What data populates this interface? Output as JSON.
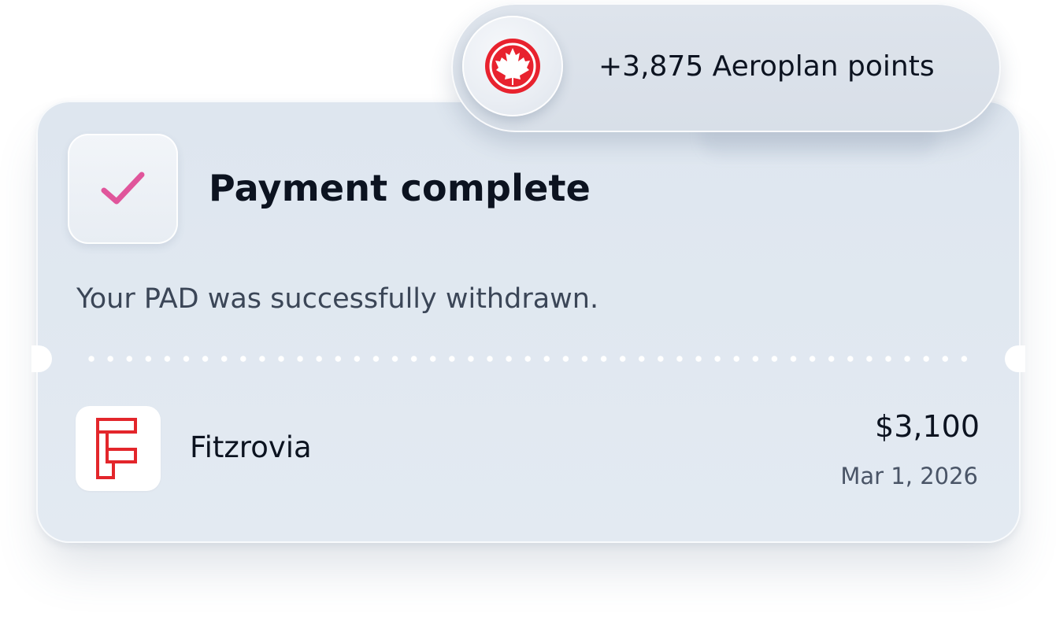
{
  "notification": {
    "title": "Payment complete",
    "message": "Your PAD was successfully withdrawn."
  },
  "rewards": {
    "text": "+3,875 Aeroplan points",
    "icon": "maple-leaf-icon",
    "brand_color": "#e8222e"
  },
  "transaction": {
    "merchant_name": "Fitzrovia",
    "merchant_logo_icon": "fitzrovia-logo-icon",
    "amount": "$3,100",
    "date": "Mar 1, 2026"
  },
  "colors": {
    "check_accent": "#e0559b",
    "text_primary": "#0c1320",
    "text_secondary": "#3b4657",
    "card_background": "#e0e8f1",
    "merchant_logo_color": "#e3262b"
  }
}
